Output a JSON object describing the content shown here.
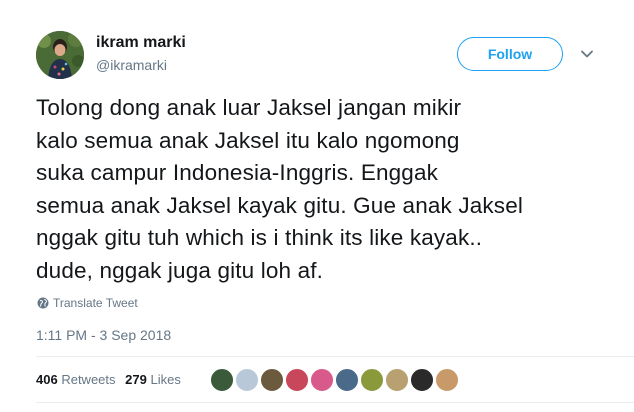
{
  "author": {
    "display_name": "ikram marki",
    "handle": "@ikramarki"
  },
  "follow_button": {
    "label": "Follow"
  },
  "menu": {
    "icon": "chevron-down-icon"
  },
  "tweet": {
    "text": "Tolong dong anak luar Jaksel jangan mikir\nkalo semua anak Jaksel itu kalo ngomong\nsuka campur Indonesia-Inggris. Enggak\nsemua anak Jaksel kayak gitu. Gue anak Jaksel\nnggak gitu tuh which is i think its like kayak..\ndude, nggak juga gitu loh af."
  },
  "translate": {
    "label": "Translate Tweet",
    "icon": "globe-icon"
  },
  "timestamp": "1:11 PM - 3 Sep 2018",
  "stats": {
    "retweets_count": "406",
    "retweets_label": "Retweets",
    "likes_count": "279",
    "likes_label": "Likes"
  },
  "likers": [
    {
      "color": "#3a5a3a"
    },
    {
      "color": "#b9c8d8"
    },
    {
      "color": "#6b5a3e"
    },
    {
      "color": "#c9475a"
    },
    {
      "color": "#d85a8a"
    },
    {
      "color": "#4a6a8a"
    },
    {
      "color": "#8a9a3a"
    },
    {
      "color": "#b8a070"
    },
    {
      "color": "#2a2a2a"
    },
    {
      "color": "#c89a6a"
    }
  ],
  "colors": {
    "accent": "#1da1f2",
    "text": "#14171a",
    "secondary": "#657786",
    "divider": "#e6ecf0"
  }
}
